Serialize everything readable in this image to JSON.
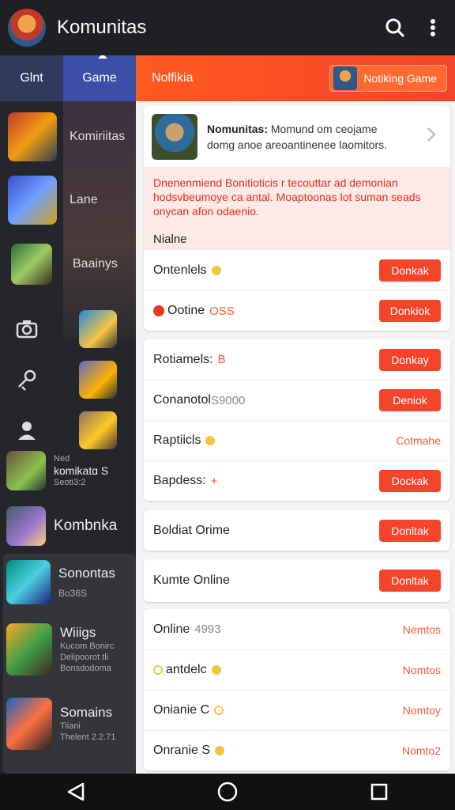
{
  "topbar": {
    "title": "Komunitas",
    "search_icon": "search-icon",
    "more_icon": "more-vert-icon"
  },
  "sidebar": {
    "tabs": [
      {
        "label": "Glnt"
      },
      {
        "label": "Game"
      }
    ],
    "rows": [
      {
        "label": "Komiriitas"
      },
      {
        "label": "Lane"
      },
      {
        "label": "Baainys"
      }
    ],
    "list": [
      {
        "name": "komikatɑ S",
        "sub1": "Ned",
        "sub2": "Seoti3:2"
      },
      {
        "name": "Kombnka"
      },
      {
        "name": "Sonontas",
        "sub1": "Bo36S"
      },
      {
        "name": "Wiiigs",
        "sub1": "Kucom Bonirc",
        "sub2": "Delipoorot tli",
        "sub3": "Bonsdodoma"
      },
      {
        "name": "Somains",
        "sub1": "Tiiani",
        "sub2": "Thelent 2.2.71"
      }
    ]
  },
  "main": {
    "header_title": "Nolfikia",
    "game_button": "Notiking Game",
    "promo": {
      "title": "Nomunitas:",
      "text1": " Momund om ceojame",
      "text2": "domg anoe areoantinenee laomitors.",
      "warning": "Dnenenmiend Bonitioticis r tecouttar ad demonian hodsvbeumoye ca antal. Moaptoonas lot suman seads onycan afon odaenio.",
      "note": "Nialne"
    },
    "group1": [
      {
        "label": "Ontenlels",
        "action": "Donkak"
      },
      {
        "label": "Ootine",
        "extra": "OSS",
        "action": "Donkiok"
      }
    ],
    "group2": [
      {
        "label": "Rotiamels:",
        "extra": "B",
        "action": "Donkay"
      },
      {
        "label": "Conanotol",
        "extra": "S9000",
        "action": "Deniok"
      },
      {
        "label": "Raptiicls",
        "link": "Cotmahe"
      },
      {
        "label": "Bapdess:",
        "extra": "+",
        "action": "Dockak"
      }
    ],
    "group3": [
      {
        "label": "Boldiat Orime",
        "action": "Donltak"
      }
    ],
    "group4": [
      {
        "label": "Kumte Online",
        "action": "Donltak"
      }
    ],
    "group5": [
      {
        "label": "Online",
        "extra": "4993",
        "link": "Nemtos"
      },
      {
        "label": "antdelc",
        "link": "Nomtos"
      },
      {
        "label": "Onianie C",
        "link": "Nomtoy"
      },
      {
        "label": "Onranie S",
        "link": "Nomto2"
      }
    ]
  },
  "navbar": {
    "back_icon": "back-icon",
    "home_icon": "home-icon",
    "recents_icon": "recents-icon"
  },
  "colors": {
    "accent": "#f4442a",
    "header_dark": "#1f2024",
    "tab_active": "#3b4fa8"
  }
}
